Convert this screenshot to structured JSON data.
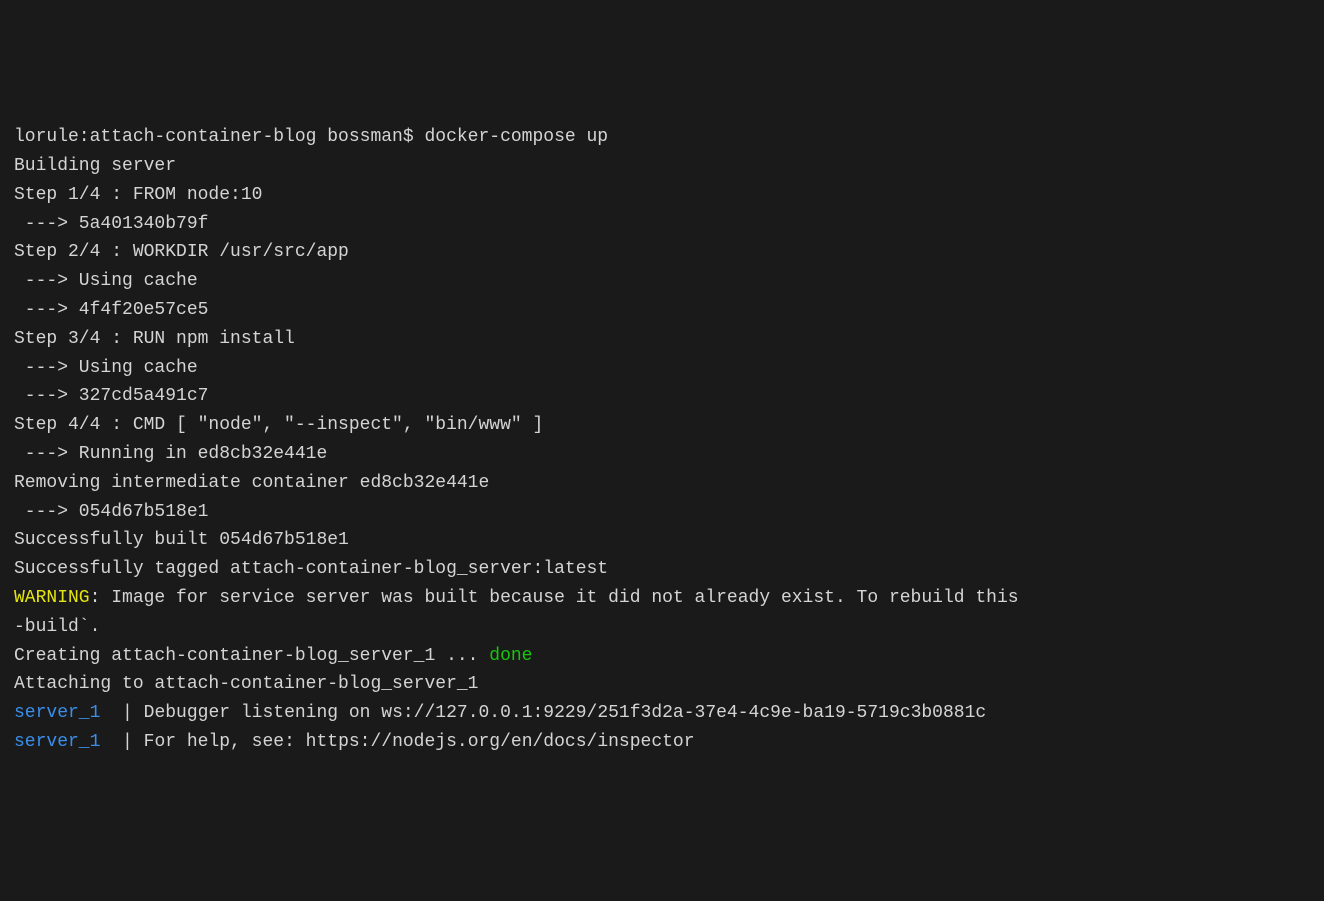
{
  "prompt": {
    "host_path": "lorule:attach-container-blog bossman$ ",
    "command": "docker-compose up"
  },
  "lines": {
    "l1": "Building server",
    "l2": "Step 1/4 : FROM node:10",
    "l3": " ---> 5a401340b79f",
    "l4": "Step 2/4 : WORKDIR /usr/src/app",
    "l5": " ---> Using cache",
    "l6": " ---> 4f4f20e57ce5",
    "l7": "Step 3/4 : RUN npm install",
    "l8": " ---> Using cache",
    "l9": " ---> 327cd5a491c7",
    "l10": "Step 4/4 : CMD [ \"node\", \"--inspect\", \"bin/www\" ]",
    "l11": " ---> Running in ed8cb32e441e",
    "l12": "Removing intermediate container ed8cb32e441e",
    "l13": " ---> 054d67b518e1",
    "l14": "",
    "l15": "Successfully built 054d67b518e1",
    "l16": "Successfully tagged attach-container-blog_server:latest",
    "warning_label": "WARNING",
    "warning_text": ": Image for service server was built because it did not already exist. To rebuild this",
    "l18": "-build`.",
    "creating_prefix": "Creating attach-container-blog_server_1 ... ",
    "done_text": "done",
    "l20": "Attaching to attach-container-blog_server_1",
    "service_label": "server_1",
    "pipe_sep": "  | ",
    "debug_l1": "Debugger listening on ws://127.0.0.1:9229/251f3d2a-37e4-4c9e-ba19-5719c3b0881c",
    "debug_l2": "For help, see: https://nodejs.org/en/docs/inspector"
  }
}
